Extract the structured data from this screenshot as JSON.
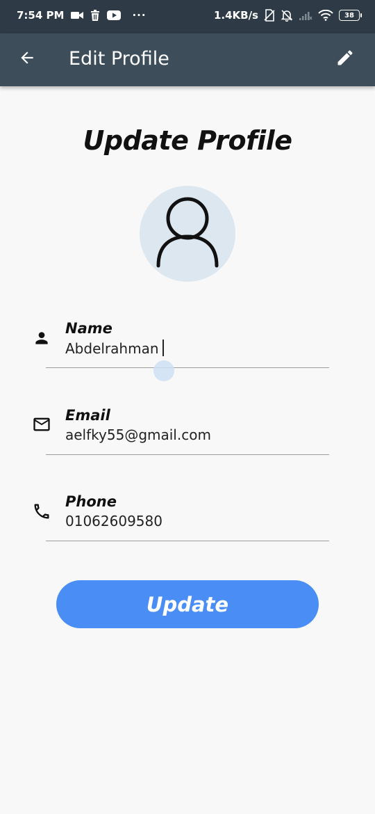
{
  "status_bar": {
    "time": "7:54 PM",
    "more": "···",
    "net_speed": "1.4KB/s",
    "battery": "38",
    "icons": [
      "video-camera-icon",
      "trash-icon",
      "youtube-icon",
      "sim-off-icon",
      "notifications-off-icon",
      "signal-icon",
      "wifi-icon",
      "battery-icon"
    ]
  },
  "app_bar": {
    "title": "Edit Profile",
    "back_icon": "arrow-back-icon",
    "edit_icon": "edit-pencil-icon",
    "background": "#3d4d5a"
  },
  "main": {
    "title": "Update Profile",
    "avatar_icon": "person-outline-icon",
    "avatar_background": "#dde7ef"
  },
  "fields": {
    "name": {
      "label": "Name",
      "value": "Abdelrahman",
      "icon": "person-icon"
    },
    "email": {
      "label": "Email",
      "value": "aelfky55@gmail.com",
      "icon": "mail-icon"
    },
    "phone": {
      "label": "Phone",
      "value": "01062609580",
      "icon": "phone-icon"
    }
  },
  "update_button": {
    "label": "Update",
    "color": "#4a8ef5"
  }
}
